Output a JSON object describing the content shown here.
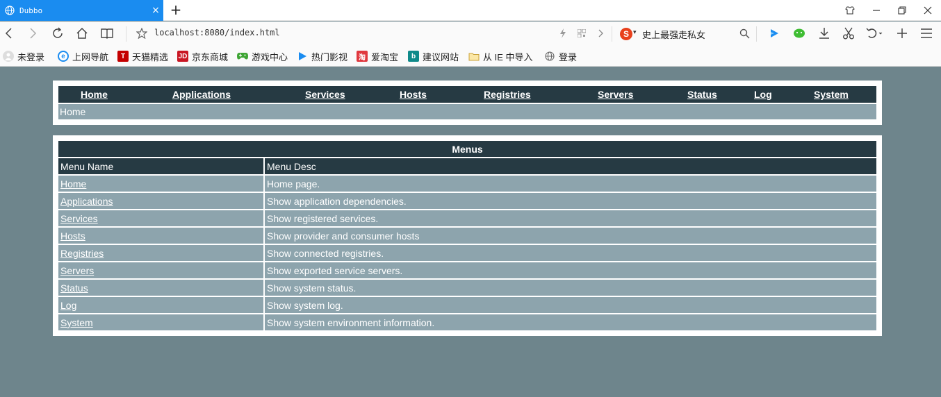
{
  "browser": {
    "tab_title": "Dubbo",
    "tab_close": "×",
    "new_tab": "+",
    "address": "localhost:8080/index.html",
    "search_text": "史上最强走私女",
    "bookmarks": [
      {
        "label": "未登录"
      },
      {
        "label": "上网导航"
      },
      {
        "label": "天猫精选"
      },
      {
        "label": "京东商城"
      },
      {
        "label": "游戏中心"
      },
      {
        "label": "热门影视"
      },
      {
        "label": "爱淘宝"
      },
      {
        "label": "建议网站"
      },
      {
        "label": "从 IE 中导入"
      },
      {
        "label": "登录"
      }
    ]
  },
  "nav": {
    "items": [
      "Home",
      "Applications",
      "Services",
      "Hosts",
      "Registries",
      "Servers",
      "Status",
      "Log",
      "System"
    ],
    "breadcrumb": "Home"
  },
  "menus": {
    "caption": "Menus",
    "headers": [
      "Menu Name",
      "Menu Desc"
    ],
    "rows": [
      {
        "name": "Home",
        "desc": "Home page."
      },
      {
        "name": "Applications",
        "desc": "Show application dependencies."
      },
      {
        "name": "Services",
        "desc": "Show registered services."
      },
      {
        "name": "Hosts",
        "desc": "Show provider and consumer hosts"
      },
      {
        "name": "Registries",
        "desc": "Show connected registries."
      },
      {
        "name": "Servers",
        "desc": "Show exported service servers."
      },
      {
        "name": "Status",
        "desc": "Show system status."
      },
      {
        "name": "Log",
        "desc": "Show system log."
      },
      {
        "name": "System",
        "desc": "Show system environment information."
      }
    ]
  },
  "colors": {
    "page_bg": "#6e858c",
    "header_bg": "#263a43",
    "row_bg": "#8da4ad",
    "tab_active": "#1a8cf0"
  }
}
